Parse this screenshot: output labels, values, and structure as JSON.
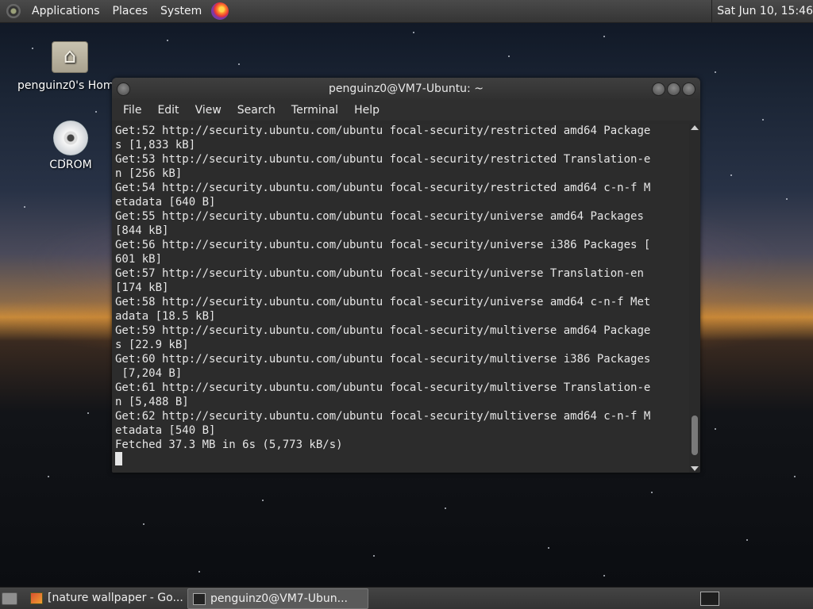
{
  "top_panel": {
    "menus": [
      "Applications",
      "Places",
      "System"
    ],
    "clock": "Sat Jun 10, 15:46",
    "icons": {
      "logo": "distro-logo-icon",
      "browser": "firefox-icon"
    }
  },
  "desktop": {
    "icons": [
      {
        "label": "penguinz0's Hom",
        "icon": "home-folder-icon"
      },
      {
        "label": "CDROM",
        "icon": "cdrom-icon"
      }
    ]
  },
  "terminal": {
    "title": "penguinz0@VM7-Ubuntu: ~",
    "menu": [
      "File",
      "Edit",
      "View",
      "Search",
      "Terminal",
      "Help"
    ],
    "lines": [
      "Get:52 http://security.ubuntu.com/ubuntu focal-security/restricted amd64 Package",
      "s [1,833 kB]",
      "Get:53 http://security.ubuntu.com/ubuntu focal-security/restricted Translation-e",
      "n [256 kB]",
      "Get:54 http://security.ubuntu.com/ubuntu focal-security/restricted amd64 c-n-f M",
      "etadata [640 B]",
      "Get:55 http://security.ubuntu.com/ubuntu focal-security/universe amd64 Packages",
      "[844 kB]",
      "Get:56 http://security.ubuntu.com/ubuntu focal-security/universe i386 Packages [",
      "601 kB]",
      "Get:57 http://security.ubuntu.com/ubuntu focal-security/universe Translation-en",
      "[174 kB]",
      "Get:58 http://security.ubuntu.com/ubuntu focal-security/universe amd64 c-n-f Met",
      "adata [18.5 kB]",
      "Get:59 http://security.ubuntu.com/ubuntu focal-security/multiverse amd64 Package",
      "s [22.9 kB]",
      "Get:60 http://security.ubuntu.com/ubuntu focal-security/multiverse i386 Packages",
      " [7,204 B]",
      "Get:61 http://security.ubuntu.com/ubuntu focal-security/multiverse Translation-e",
      "n [5,488 B]",
      "Get:62 http://security.ubuntu.com/ubuntu focal-security/multiverse amd64 c-n-f M",
      "etadata [540 B]",
      "Fetched 37.3 MB in 6s (5,773 kB/s)"
    ]
  },
  "taskbar": {
    "tasks": [
      {
        "label": "[nature wallpaper - Go...",
        "icon": "firefox-icon"
      },
      {
        "label": "penguinz0@VM7-Ubun...",
        "icon": "terminal-icon"
      }
    ]
  }
}
